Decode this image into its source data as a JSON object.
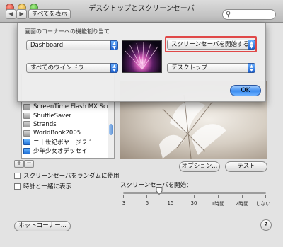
{
  "window": {
    "title": "デスクトップとスクリーンセーバ",
    "back_glyph": "◀",
    "forward_glyph": "▶",
    "show_all_label": "すべてを表示",
    "search_placeholder": ""
  },
  "hot_corners_sheet": {
    "title": "画面のコーナーへの機能割り当て",
    "top_left": "Dashboard",
    "top_right": "スクリーンセーバを開始する",
    "bottom_left": "すべてのウインドウ",
    "bottom_right": "デスクトップ",
    "ok_label": "OK"
  },
  "saver_list": {
    "items": [
      {
        "label": "ScreenTime Flash MX Scr...",
        "icon": "gray-saver-icon"
      },
      {
        "label": "ShuffleSaver",
        "icon": "gray-saver-icon"
      },
      {
        "label": "Strands",
        "icon": "gray-saver-icon"
      },
      {
        "label": "WorldBook2005",
        "icon": "gray-saver-icon"
      },
      {
        "label": "二十世紀ボヤージ 2.1",
        "icon": "blue-saver-icon"
      },
      {
        "label": "少年少女オデッセイ",
        "icon": "blue-saver-icon"
      }
    ],
    "add_label": "+",
    "remove_label": "−"
  },
  "controls": {
    "options_label": "オプション...",
    "test_label": "テスト",
    "random_label": "スクリーンセーバをランダムに使用",
    "clock_label": "時計と一緒に表示",
    "hot_corners_label": "ホットコーナー...",
    "help_label": "?"
  },
  "slider": {
    "label": "スクリーンセーバを開始：",
    "ticks": [
      "3",
      "5",
      "15",
      "30",
      "1時間",
      "2時間",
      "しない"
    ],
    "selected_tick": "15"
  },
  "colors": {
    "accent_blue": "#3a8cf0",
    "highlight_red": "#e04848"
  }
}
